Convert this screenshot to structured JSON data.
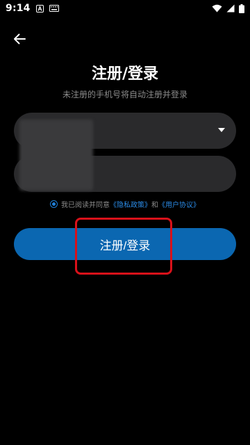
{
  "status_bar": {
    "time": "9:14",
    "icons": [
      "a-icon",
      "keyboard-icon",
      "wifi-icon",
      "signal-icon",
      "battery-icon"
    ]
  },
  "header": {
    "back_icon": "arrow-left-icon",
    "title": "注册/登录",
    "subtitle": "未注册的手机号将自动注册并登录"
  },
  "form": {
    "country_field": {
      "value": "",
      "dropdown_icon": "caret-down-icon"
    },
    "phone_field": {
      "value": ""
    }
  },
  "agreement": {
    "prefix": "我已阅读并同意",
    "privacy_link": "《隐私政策》",
    "and": "和",
    "terms_link": "《用户协议》",
    "checked": true
  },
  "primary_button": {
    "label": "注册/登录"
  },
  "colors": {
    "background": "#000000",
    "field": "#2a2a2c",
    "primary": "#0b67b1",
    "link": "#2b8be6",
    "highlight": "#d9111a"
  }
}
